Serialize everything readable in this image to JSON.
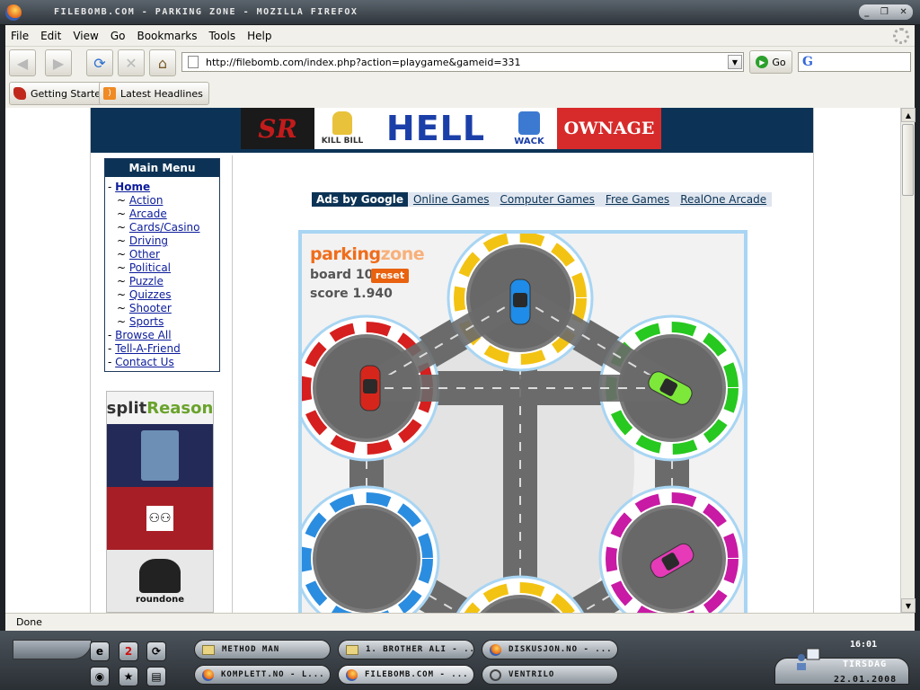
{
  "window": {
    "title": "FILEBOMB.COM - PARKING ZONE - MOZILLA FIREFOX",
    "controls": [
      "_",
      "❐",
      "✕"
    ]
  },
  "menu": [
    "File",
    "Edit",
    "View",
    "Go",
    "Bookmarks",
    "Tools",
    "Help"
  ],
  "navigation": {
    "url": "http://filebomb.com/index.php?action=playgame&gameid=331",
    "go_label": "Go"
  },
  "bookmarks": [
    {
      "label": "Getting Started",
      "icon": "getting-started-icon"
    },
    {
      "label": "Latest Headlines",
      "icon": "rss-feed-icon"
    }
  ],
  "banner": {
    "logos": [
      "SR",
      "KILL BILL",
      "HELL",
      "WACK",
      "OWNAGE"
    ]
  },
  "main_menu": {
    "title": "Main Menu",
    "items": [
      {
        "label": "Home",
        "level": 0
      },
      {
        "label": "Action",
        "level": 1
      },
      {
        "label": "Arcade",
        "level": 1
      },
      {
        "label": "Cards/Casino",
        "level": 1
      },
      {
        "label": "Driving",
        "level": 1
      },
      {
        "label": "Other",
        "level": 1
      },
      {
        "label": "Political",
        "level": 1
      },
      {
        "label": "Puzzle",
        "level": 1
      },
      {
        "label": "Quizzes",
        "level": 1
      },
      {
        "label": "Shooter",
        "level": 1
      },
      {
        "label": "Sports",
        "level": 1
      },
      {
        "label": "Browse All",
        "level": 0
      },
      {
        "label": "Tell-A-Friend",
        "level": 0
      },
      {
        "label": "Contact Us",
        "level": 0
      }
    ]
  },
  "side_ads": {
    "brand_a": "split",
    "brand_b": "Reason",
    "ad3_text": "roundone"
  },
  "ads_bar": {
    "label": "Ads by Google",
    "links": [
      "Online Games",
      "Computer Games",
      "Free Games",
      "RealOne Arcade"
    ]
  },
  "game": {
    "title_a": "parking",
    "title_b": "zone",
    "board_label": "board 10",
    "reset_label": "reset",
    "score_label": "score 1.940",
    "colors": {
      "top": "#f3c313",
      "left": "#d61f1f",
      "right": "#27c81f",
      "bottom_left": "#2b8de0",
      "bottom_right": "#c81aa5",
      "ring": "#a8d5f3",
      "road": "#6b6b6b"
    },
    "cars": [
      "blue",
      "red",
      "green",
      "pink"
    ]
  },
  "status": {
    "text": "Done"
  },
  "taskbar": {
    "quick_launch": [
      "e",
      "2",
      "⟳",
      "◉",
      "★",
      "▤"
    ],
    "tasks": [
      {
        "label": "METHOD MAN",
        "icon": "folder-icon"
      },
      {
        "label": "1. BROTHER ALI - ...",
        "icon": "media-icon"
      },
      {
        "label": "DISKUSJON.NO - ...",
        "icon": "firefox-icon"
      },
      {
        "label": "KOMPLETT.NO - L...",
        "icon": "firefox-icon"
      },
      {
        "label": "FILEBOMB.COM - ...",
        "icon": "firefox-icon"
      },
      {
        "label": "VENTRILO",
        "icon": "ventrilo-icon"
      }
    ],
    "clock_time": "16:01",
    "clock_day": "TIRSDAG",
    "clock_date": "22.01.2008"
  }
}
